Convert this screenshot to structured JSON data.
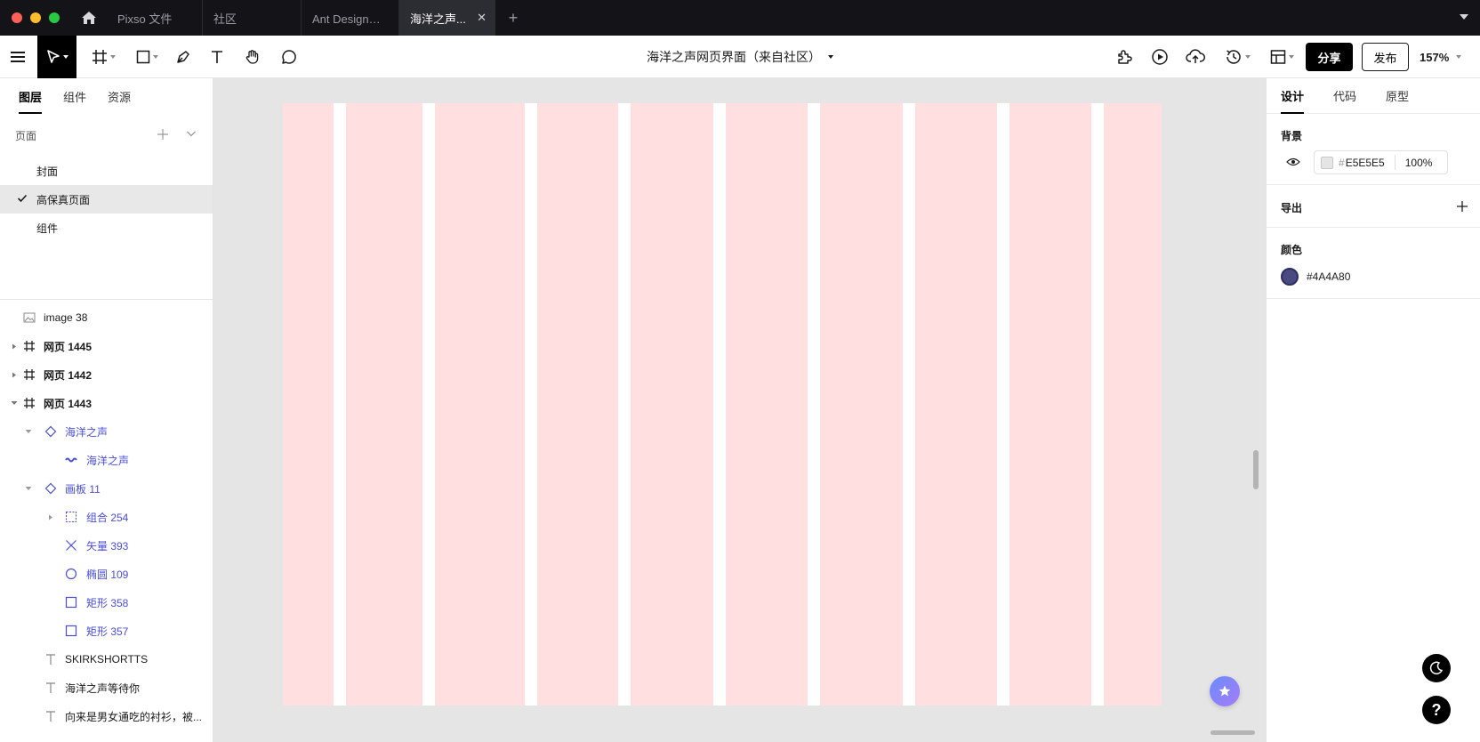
{
  "titlebar": {
    "tabs": [
      {
        "label": "Pixso 文件",
        "active": false
      },
      {
        "label": "社区",
        "active": false
      },
      {
        "label": "Ant Design设...",
        "active": false
      },
      {
        "label": "海洋之声...",
        "active": true
      }
    ],
    "new_tab_symbol": "+",
    "close_symbol": "✕"
  },
  "toolbar": {
    "document_title": "海洋之声网页界面（来自社区）",
    "share_label": "分享",
    "publish_label": "发布",
    "zoom": "157%",
    "tools": [
      "menu-icon",
      "move-tool-icon",
      "frame-tool-icon",
      "shape-tool-icon",
      "pen-tool-icon",
      "text-tool-icon",
      "hand-tool-icon",
      "comment-tool-icon"
    ],
    "right_icons": [
      "plugin-icon",
      "play-icon",
      "upload-icon",
      "history-icon",
      "layout-icon"
    ]
  },
  "left_panel": {
    "tabs": [
      "图层",
      "组件",
      "资源"
    ],
    "active_tab": "图层",
    "pages_heading": "页面",
    "pages": [
      {
        "label": "封面",
        "selected": false
      },
      {
        "label": "高保真页面",
        "selected": true
      },
      {
        "label": "组件",
        "selected": false
      }
    ],
    "layers": [
      {
        "label": "image 38",
        "icon": "image-icon"
      },
      {
        "label": "网页 1445",
        "icon": "frame-icon"
      },
      {
        "label": "网页 1442",
        "icon": "frame-icon"
      },
      {
        "label": "网页 1443",
        "icon": "frame-icon"
      },
      {
        "label": "海洋之声",
        "icon": "component-icon"
      },
      {
        "label": "海洋之声",
        "icon": "instance-icon"
      },
      {
        "label": "画板 11",
        "icon": "component-icon"
      },
      {
        "label": "组合 254",
        "icon": "group-icon"
      },
      {
        "label": "矢量 393",
        "icon": "vector-icon"
      },
      {
        "label": "椭圆 109",
        "icon": "ellipse-icon"
      },
      {
        "label": "矩形 358",
        "icon": "rectangle-icon"
      },
      {
        "label": "矩形 357",
        "icon": "rectangle-icon"
      },
      {
        "label": "SKIRKSHORTTS",
        "icon": "text-icon"
      },
      {
        "label": "海洋之声等待你",
        "icon": "text-icon"
      },
      {
        "label": "向来是男女通吃的衬衫，被...",
        "icon": "text-icon"
      }
    ]
  },
  "right_panel": {
    "tabs": [
      "设计",
      "代码",
      "原型"
    ],
    "active_tab": "设计",
    "background": {
      "title": "背景",
      "hash": "#",
      "hex": "E5E5E5",
      "opacity": "100%"
    },
    "export": {
      "title": "导出"
    },
    "colors": {
      "title": "颜色",
      "hex": "#4A4A80"
    }
  },
  "colors": {
    "titlebar": "#141418",
    "artboard": "#ffdfe0",
    "canvas": "#e5e5e5",
    "accent_layer": "#4a4ed6",
    "swatch": "#4a4a80"
  }
}
